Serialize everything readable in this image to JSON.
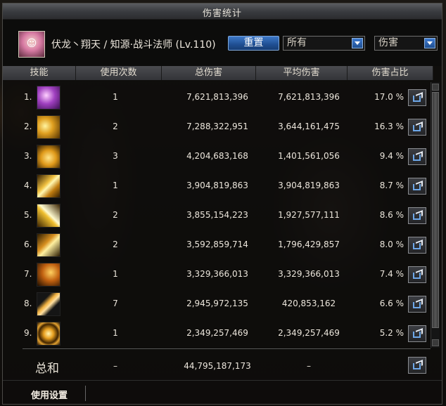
{
  "window": {
    "title": "伤害统计"
  },
  "header": {
    "character_name": "伏龙丶翔天 / 知源·战斗法师 (Lv.110)",
    "reset_button": "重置",
    "filter_select": "所有",
    "type_select": "伤害"
  },
  "columns": [
    "技能",
    "使用次数",
    "总伤害",
    "平均伤害",
    "伤害占比"
  ],
  "rows": [
    {
      "index": "1.",
      "icon": "purple-lightning-skill-icon",
      "uses": "1",
      "total": "7,621,813,396",
      "average": "7,621,813,396",
      "percent": "17.0 %"
    },
    {
      "index": "2.",
      "icon": "golden-stars-skill-icon",
      "uses": "2",
      "total": "7,288,322,951",
      "average": "3,644,161,475",
      "percent": "16.3 %"
    },
    {
      "index": "3.",
      "icon": "golden-flame-skill-icon",
      "uses": "3",
      "total": "4,204,683,168",
      "average": "1,401,561,056",
      "percent": "9.4 %"
    },
    {
      "index": "4.",
      "icon": "golden-burst-skill-icon",
      "uses": "1",
      "total": "3,904,819,863",
      "average": "3,904,819,863",
      "percent": "8.7 %"
    },
    {
      "index": "5.",
      "icon": "golden-slash-skill-icon",
      "uses": "2",
      "total": "3,855,154,223",
      "average": "1,927,577,111",
      "percent": "8.6 %"
    },
    {
      "index": "6.",
      "icon": "golden-staff-strike-skill-icon",
      "uses": "2",
      "total": "3,592,859,714",
      "average": "1,796,429,857",
      "percent": "8.0 %"
    },
    {
      "index": "7.",
      "icon": "golden-wave-skill-icon",
      "uses": "1",
      "total": "3,329,366,013",
      "average": "3,329,366,013",
      "percent": "7.4 %"
    },
    {
      "index": "8.",
      "icon": "golden-staff-skill-icon",
      "uses": "7",
      "total": "2,945,972,135",
      "average": "420,853,162",
      "percent": "6.6 %"
    },
    {
      "index": "9.",
      "icon": "golden-vortex-skill-icon",
      "uses": "1",
      "total": "2,349,257,469",
      "average": "2,349,257,469",
      "percent": "5.2 %"
    }
  ],
  "totals": {
    "label": "总和",
    "uses": "–",
    "total": "44,795,187,173",
    "average": "–"
  },
  "footer": {
    "settings_label": "使用设置"
  },
  "colors": {
    "accent_blue": "#2a5ea8",
    "header_gray": "#404145",
    "text": "#ece6dc"
  }
}
